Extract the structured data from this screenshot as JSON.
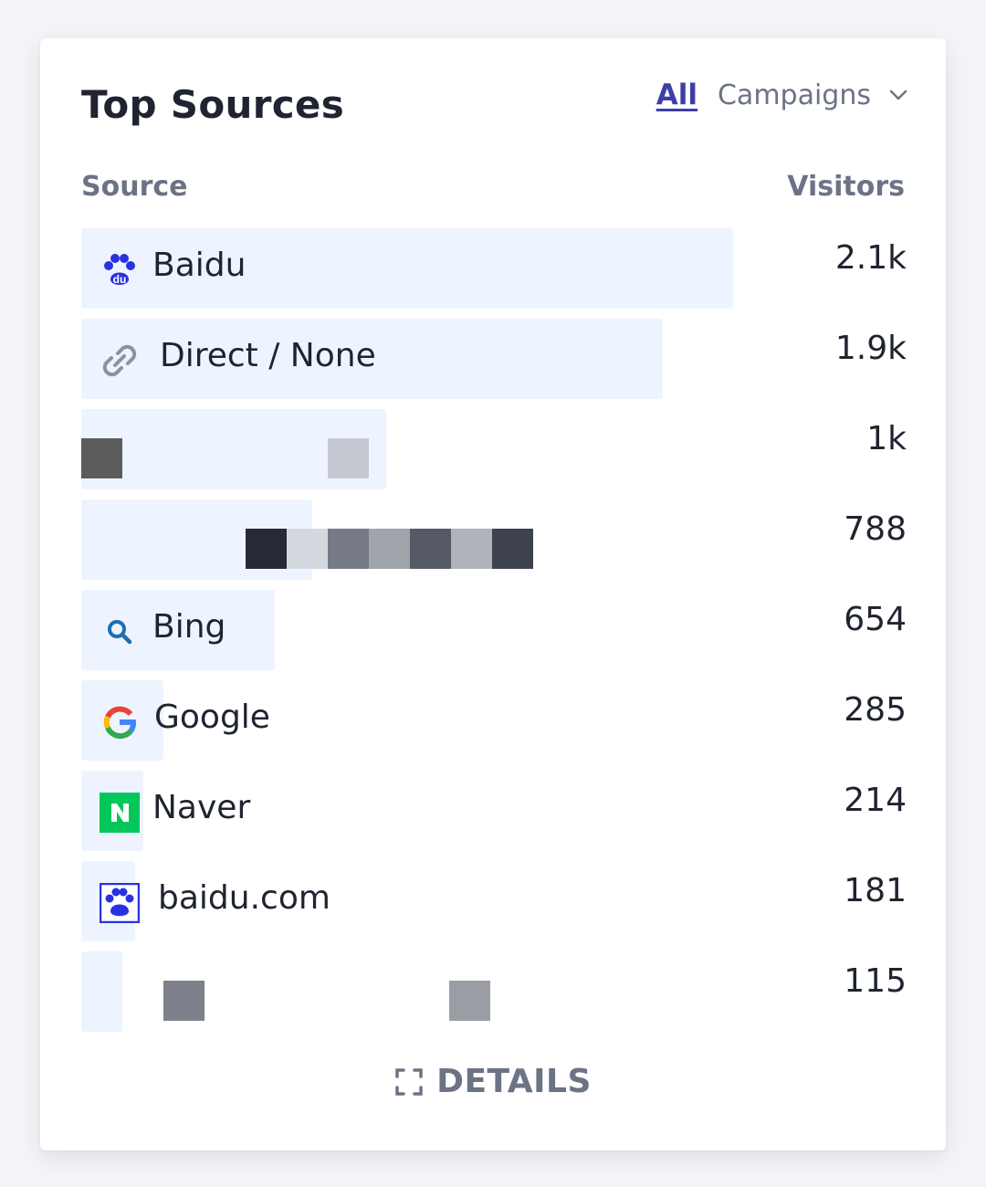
{
  "card": {
    "title": "Top Sources",
    "tabs": {
      "all_label": "All",
      "campaigns_label": "Campaigns"
    },
    "columns": {
      "source": "Source",
      "visitors": "Visitors"
    },
    "details_label": "DETAILS"
  },
  "rows": [
    {
      "label": "Baidu",
      "value": "2.1k",
      "icon": "baidu-paw-icon",
      "share": 0.79
    },
    {
      "label": "Direct / None",
      "value": "1.9k",
      "icon": "link-icon",
      "share": 0.705
    },
    {
      "label": "",
      "value": "1k",
      "icon": "redacted",
      "share": 0.37
    },
    {
      "label": "",
      "value": "788",
      "icon": "redacted",
      "share": 0.28
    },
    {
      "label": "Bing",
      "value": "654",
      "icon": "search-icon",
      "share": 0.235
    },
    {
      "label": "Google",
      "value": "285",
      "icon": "google-icon",
      "share": 0.1
    },
    {
      "label": "Naver",
      "value": "214",
      "icon": "naver-icon",
      "share": 0.075
    },
    {
      "label": "baidu.com",
      "value": "181",
      "icon": "baidu-paw-icon",
      "share": 0.065
    },
    {
      "label": "",
      "value": "115",
      "icon": "redacted",
      "share": 0.05
    }
  ],
  "colors": {
    "bar": "#eef4ff",
    "accent": "#3b3fa8",
    "muted": "#6b7385",
    "text": "#1f2430"
  }
}
